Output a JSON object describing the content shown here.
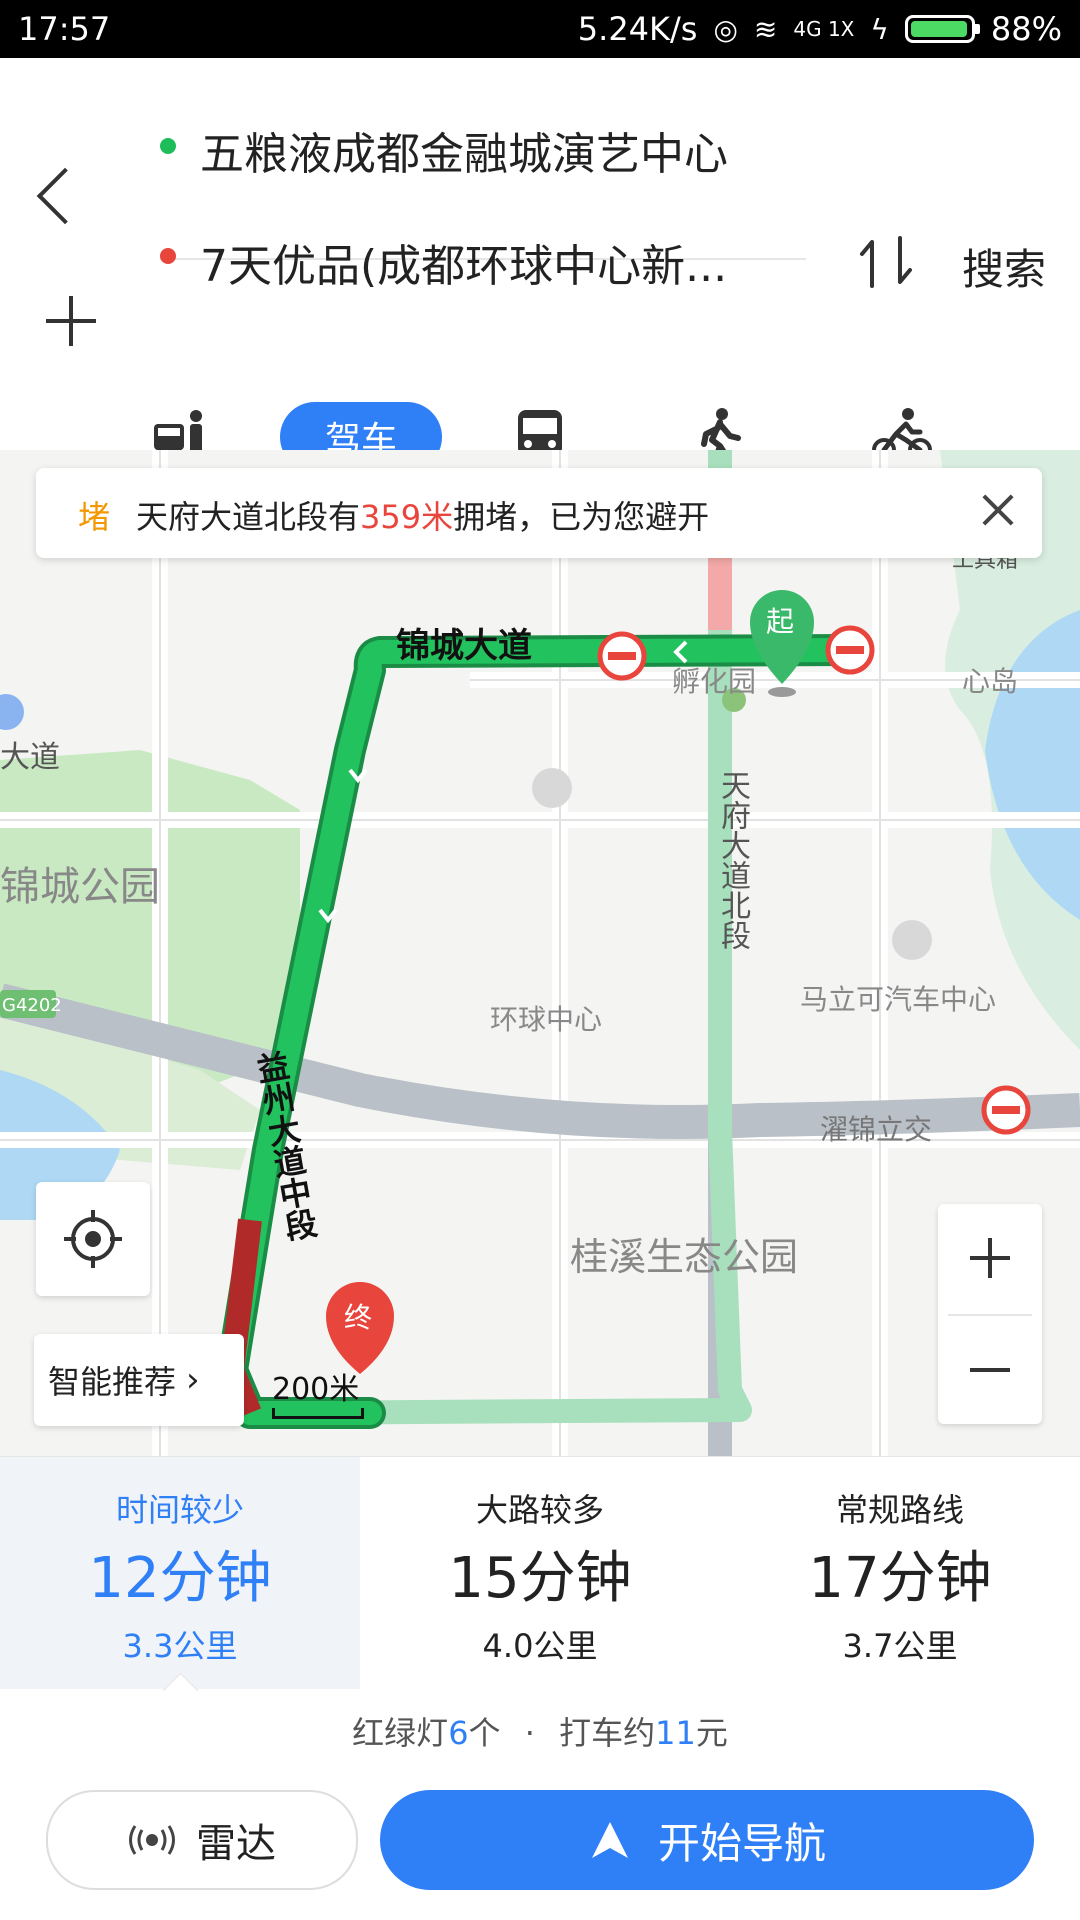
{
  "status_bar": {
    "time": "17:57",
    "net_speed": "5.24K/s",
    "signal_label": "4G 1X",
    "battery": "88%",
    "battery_level": 0.88
  },
  "route_inputs": {
    "origin": "五粮液成都金融城演艺中心",
    "destination": "7天优品(成都环球中心新...",
    "search_label": "搜索"
  },
  "modes": {
    "active_label": "驾车",
    "icons": [
      "taxi-icon",
      "car-icon",
      "bus-icon",
      "walk-icon",
      "bike-icon"
    ]
  },
  "notice": {
    "tag": "堵",
    "prefix": "天府大道北段有",
    "distance": "359米",
    "suffix": "拥堵，已为您避开"
  },
  "map": {
    "labels": {
      "jincheng_road": "锦城大道",
      "fuhua": "孵化园",
      "xindao": "心岛",
      "west_road": "大道",
      "jincheng_park": "锦城公园",
      "g4202": "G4202",
      "tianfu": "天府大道北段",
      "huanqiu": "环球中心",
      "mali": "马立可汽车中心",
      "zhuojin": "濯锦立交",
      "guixi": "桂溪生态公园",
      "yizhou": "益州大道中段",
      "toolbox": "工具箱",
      "start": "起",
      "end": "终"
    },
    "scale": "200米",
    "smart_recommend": "智能推荐"
  },
  "routes": [
    {
      "label": "时间较少",
      "time": "12分钟",
      "distance": "3.3公里",
      "selected": true
    },
    {
      "label": "大路较多",
      "time": "15分钟",
      "distance": "4.0公里",
      "selected": false
    },
    {
      "label": "常规路线",
      "time": "17分钟",
      "distance": "3.7公里",
      "selected": false
    }
  ],
  "summary": {
    "lights_prefix": "红绿灯",
    "lights": "6",
    "lights_suffix": "个",
    "sep": "·",
    "taxi_prefix": "打车约",
    "taxi": "11",
    "taxi_suffix": "元"
  },
  "buttons": {
    "radar": "雷达",
    "start_nav": "开始导航"
  },
  "colors": {
    "accent": "#2f7ff7",
    "route_green": "#1dbd5a",
    "jam_red": "#c0282c",
    "warning": "#f39800"
  }
}
